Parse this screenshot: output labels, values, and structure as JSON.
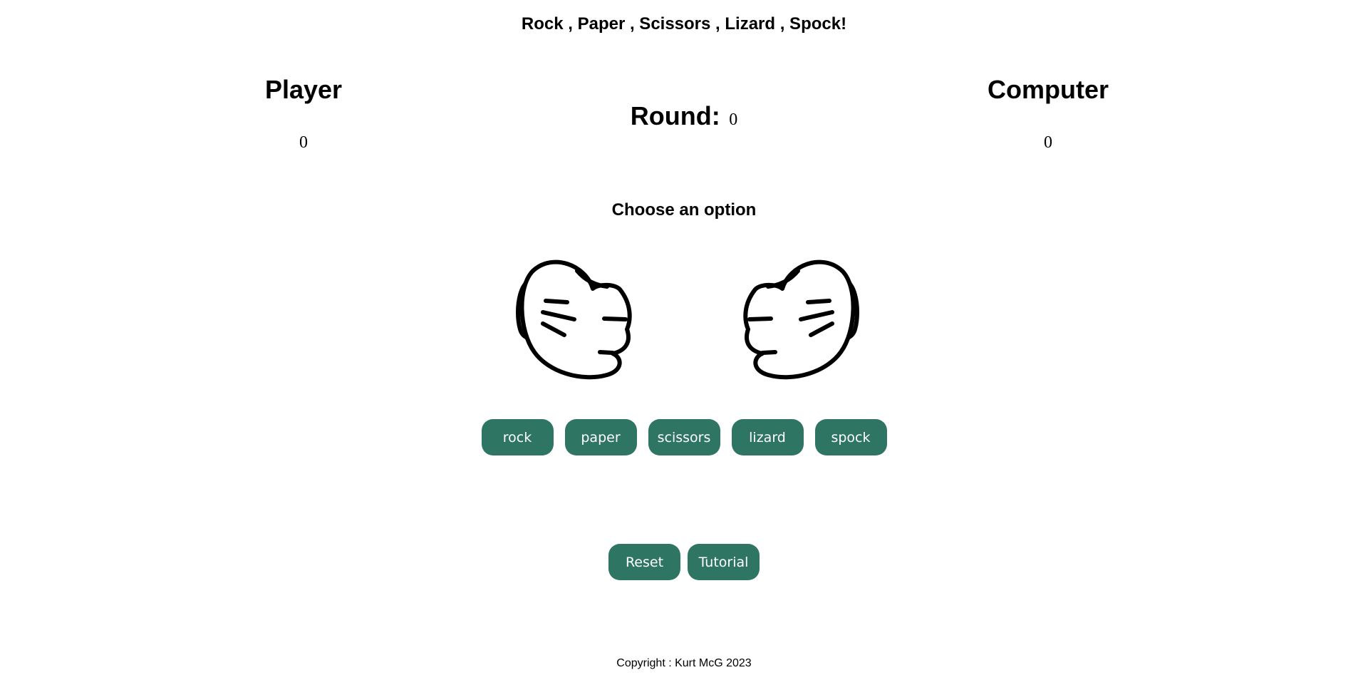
{
  "header": {
    "title": "Rock , Paper , Scissors , Lizard , Spock!"
  },
  "scoreboard": {
    "player": {
      "label": "Player",
      "score": "0"
    },
    "round": {
      "label": "Round:",
      "value": "0"
    },
    "computer": {
      "label": "Computer",
      "score": "0"
    }
  },
  "prompt": "Choose an option",
  "hands": {
    "player_hand_icon": "fist-icon",
    "computer_hand_icon": "fist-icon"
  },
  "choices": [
    {
      "id": "rock",
      "label": "rock"
    },
    {
      "id": "paper",
      "label": "paper"
    },
    {
      "id": "scissors",
      "label": "scissors"
    },
    {
      "id": "lizard",
      "label": "lizard"
    },
    {
      "id": "spock",
      "label": "spock"
    }
  ],
  "controls": {
    "reset_label": "Reset",
    "tutorial_label": "Tutorial"
  },
  "footer": {
    "copyright": "Copyright : Kurt McG 2023"
  },
  "colors": {
    "button_bg": "#2e7563",
    "button_text": "#ffffff",
    "background": "#ffffff",
    "text": "#000000"
  }
}
